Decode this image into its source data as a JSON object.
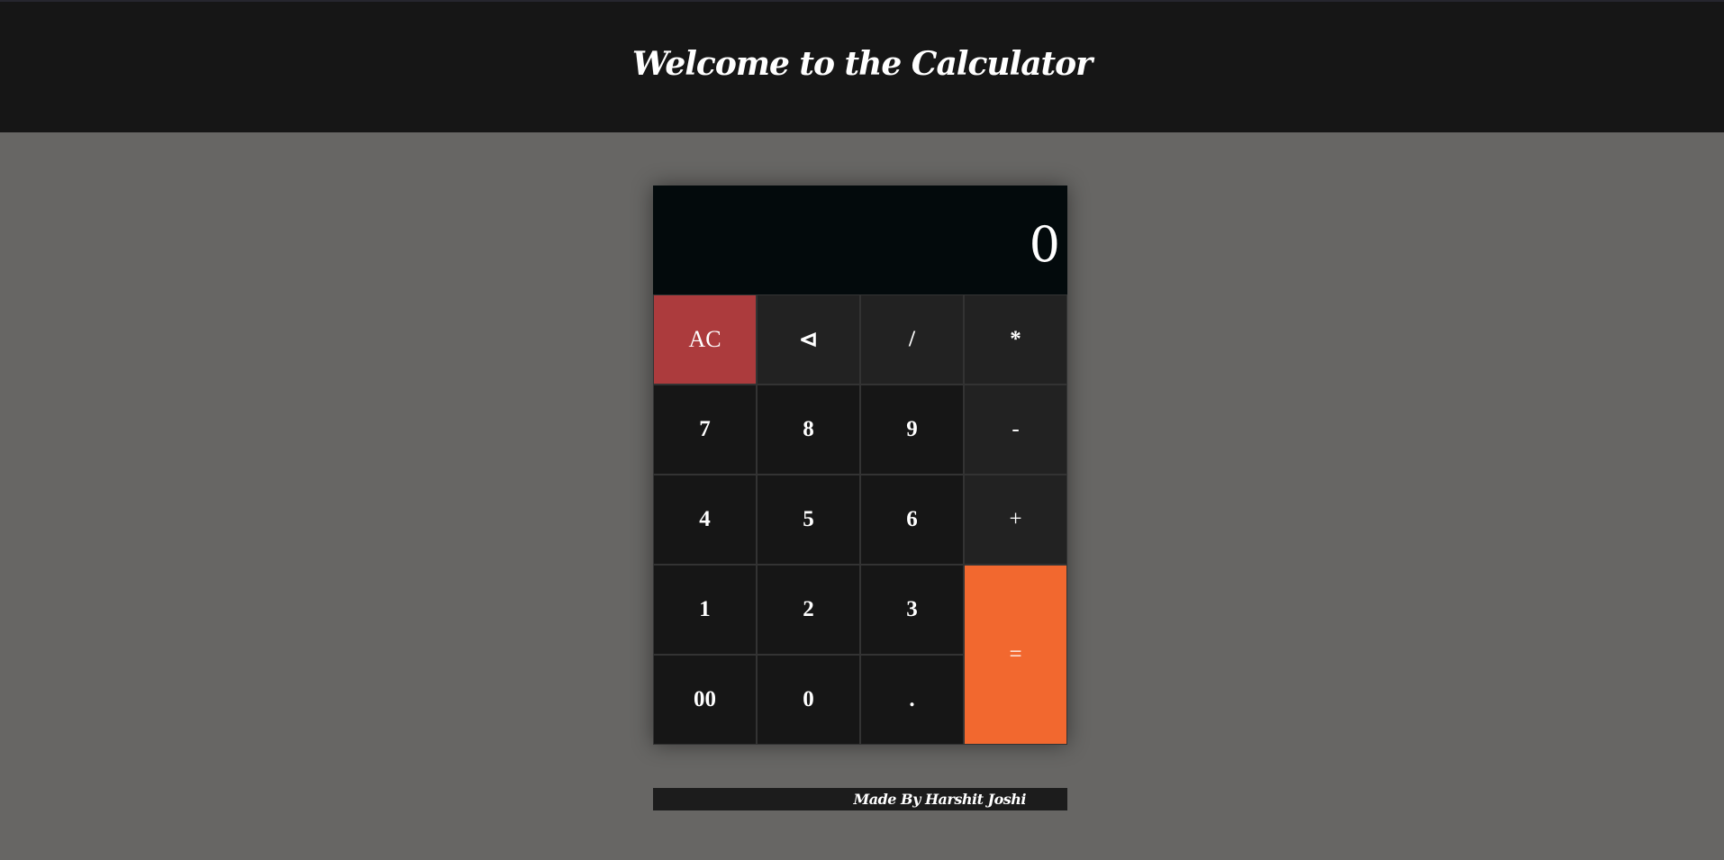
{
  "header": {
    "title": "Welcome to the Calculator"
  },
  "display": {
    "value": "0"
  },
  "keys": {
    "clear": "AC",
    "backspace": "⊲",
    "divide": "/",
    "multiply": "*",
    "seven": "7",
    "eight": "8",
    "nine": "9",
    "minus": "-",
    "four": "4",
    "five": "5",
    "six": "6",
    "plus": "+",
    "one": "1",
    "two": "2",
    "three": "3",
    "equals": "=",
    "double_zero": "00",
    "zero": "0",
    "decimal": "."
  },
  "footer": {
    "credit": "Made By Harshit Joshi"
  },
  "colors": {
    "page_background": "#676664",
    "header_background": "#161616",
    "display_background": "#030a0c",
    "clear_key": "#ac3b3d",
    "equals_key": "#f2682f",
    "operator_key": "#222222",
    "digit_key": "#161616"
  }
}
